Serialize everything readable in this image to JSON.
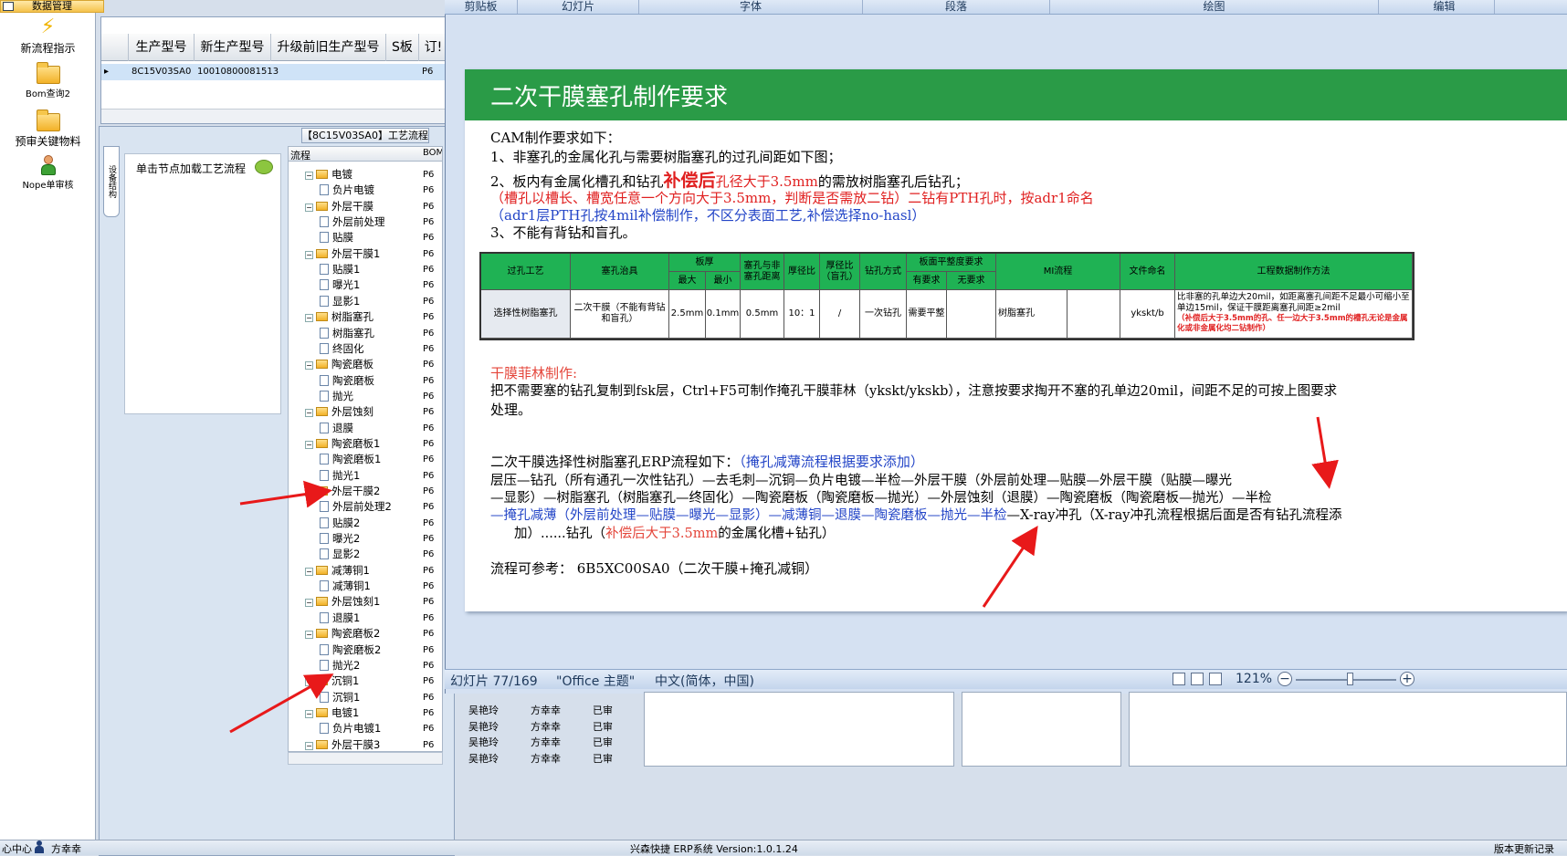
{
  "launcher": {
    "header": "数据管理",
    "items": [
      {
        "label": "新流程指示",
        "icon": "lightning-icon"
      },
      {
        "label": "Bom查询2",
        "icon": "folder-icon"
      },
      {
        "label": "预审关键物料",
        "icon": "folder-icon"
      },
      {
        "label": "Nope单审核",
        "icon": "user-icon"
      }
    ]
  },
  "grid": {
    "columns": [
      "生产型号",
      "新生产型号",
      "升级前旧生产型号",
      "S板",
      "订!"
    ],
    "row": {
      "marker": "▸",
      "c1": "8C15V03SA0",
      "c2": "10010800081513",
      "c3": "P6"
    }
  },
  "process": {
    "title": "【8C15V03SA0】工艺流程",
    "vertical_tab": "设备结构",
    "hint": "单击节点加载工艺流程",
    "tree_header": [
      "流程",
      "BOM_"
    ],
    "nodes": [
      {
        "label": "电镀",
        "level": 0,
        "bom": "P6"
      },
      {
        "label": "负片电镀",
        "level": 1,
        "bom": "P6"
      },
      {
        "label": "外层干膜",
        "level": 0,
        "bom": "P6"
      },
      {
        "label": "外层前处理",
        "level": 1,
        "bom": "P6"
      },
      {
        "label": "贴膜",
        "level": 1,
        "bom": "P6"
      },
      {
        "label": "外层干膜1",
        "level": 0,
        "bom": "P6"
      },
      {
        "label": "贴膜1",
        "level": 1,
        "bom": "P6"
      },
      {
        "label": "曝光1",
        "level": 1,
        "bom": "P6"
      },
      {
        "label": "显影1",
        "level": 1,
        "bom": "P6"
      },
      {
        "label": "树脂塞孔",
        "level": 0,
        "bom": "P6"
      },
      {
        "label": "树脂塞孔",
        "level": 1,
        "bom": "P6"
      },
      {
        "label": "终固化",
        "level": 1,
        "bom": "P6"
      },
      {
        "label": "陶瓷磨板",
        "level": 0,
        "bom": "P6"
      },
      {
        "label": "陶瓷磨板",
        "level": 1,
        "bom": "P6"
      },
      {
        "label": "抛光",
        "level": 1,
        "bom": "P6"
      },
      {
        "label": "外层蚀刻",
        "level": 0,
        "bom": "P6"
      },
      {
        "label": "退膜",
        "level": 1,
        "bom": "P6"
      },
      {
        "label": "陶瓷磨板1",
        "level": 0,
        "bom": "P6"
      },
      {
        "label": "陶瓷磨板1",
        "level": 1,
        "bom": "P6"
      },
      {
        "label": "抛光1",
        "level": 1,
        "bom": "P6"
      },
      {
        "label": "外层干膜2",
        "level": 0,
        "bom": "P6"
      },
      {
        "label": "外层前处理2",
        "level": 1,
        "bom": "P6"
      },
      {
        "label": "贴膜2",
        "level": 1,
        "bom": "P6"
      },
      {
        "label": "曝光2",
        "level": 1,
        "bom": "P6"
      },
      {
        "label": "显影2",
        "level": 1,
        "bom": "P6"
      },
      {
        "label": "减薄铜1",
        "level": 0,
        "bom": "P6"
      },
      {
        "label": "减薄铜1",
        "level": 1,
        "bom": "P6"
      },
      {
        "label": "外层蚀刻1",
        "level": 0,
        "bom": "P6"
      },
      {
        "label": "退膜1",
        "level": 1,
        "bom": "P6"
      },
      {
        "label": "陶瓷磨板2",
        "level": 0,
        "bom": "P6"
      },
      {
        "label": "陶瓷磨板2",
        "level": 1,
        "bom": "P6"
      },
      {
        "label": "抛光2",
        "level": 1,
        "bom": "P6"
      },
      {
        "label": "沉铜1",
        "level": 0,
        "bom": "P6"
      },
      {
        "label": "沉铜1",
        "level": 1,
        "bom": "P6"
      },
      {
        "label": "电镀1",
        "level": 0,
        "bom": "P6"
      },
      {
        "label": "负片电镀1",
        "level": 1,
        "bom": "P6"
      },
      {
        "label": "外层干膜3",
        "level": 0,
        "bom": "P6"
      }
    ],
    "approvals": [
      {
        "a": "吴艳玲",
        "b": "方幸幸",
        "c": "已审"
      },
      {
        "a": "吴艳玲",
        "b": "方幸幸",
        "c": "已审"
      },
      {
        "a": "吴艳玲",
        "b": "方幸幸",
        "c": "已审"
      },
      {
        "a": "吴艳玲",
        "b": "方幸幸",
        "c": "已审"
      }
    ]
  },
  "ppt": {
    "ribbon_groups": [
      "剪贴板",
      "幻灯片",
      "字体",
      "段落",
      "绘图",
      "编辑"
    ],
    "slide_title": "二次干膜塞孔制作要求",
    "lines": {
      "l1": "CAM制作要求如下：",
      "l2": "1、非塞孔的金属化孔与需要树脂塞孔的过孔间距如下图；",
      "l3a": "2、板内有金属化槽孔和钻孔",
      "l3b": "补偿后",
      "l3c": "孔径大于3.5mm",
      "l3d": "的需放树脂塞孔后钻孔；",
      "l4": "（槽孔以槽长、槽宽任意一个方向大于3.5mm，判断是否需放二钻）二钻有PTH孔时，按adr1命名",
      "l5": "（adr1层PTH孔按4mil补偿制作，不区分表面工艺,补偿选择no-hasl）",
      "l6": "3、不能有背钻和盲孔。",
      "fl_title": "干膜菲林制作:",
      "fl1": "把不需要塞的钻孔复制到fsk层，Ctrl+F5可制作掩孔干膜菲林（ykskt/ykskb），注意按要求掏开不塞的孔单边20mil，间距不足的可按上图要求",
      "fl2": "处理。",
      "erp_a": "二次干膜选择性树脂塞孔ERP流程如下：",
      "erp_b": "（掩孔减薄流程根据要求添加）",
      "f1": "层压—钻孔（所有通孔一次性钻孔）—去毛刺—沉铜—负片电镀—半检—外层干膜（外层前处理—贴膜—外层干膜（贴膜—曝光",
      "f2": "—显影）—树脂塞孔（树脂塞孔—终固化）—陶瓷磨板（陶瓷磨板—抛光）—外层蚀刻（退膜）—陶瓷磨板（陶瓷磨板—抛光）—半检",
      "f3a": "—掩孔减薄（外层前处理—贴膜—曝光—显影）—减薄铜—退膜—陶瓷磨板—抛光—半检",
      "f3b": "—X-ray冲孔（X-ray冲孔流程根据后面是否有钻孔流程添",
      "f4a": "加）......钻孔（",
      "f4b": "补偿后大于3.5mm",
      "f4c": "的金属化槽+钻孔）",
      "ref": "流程可参考：   6B5XC00SA0（二次干膜+掩孔减铜）"
    },
    "table": {
      "h": [
        "过孔工艺",
        "塞孔治具",
        "板厚",
        "塞孔与非塞孔距离",
        "厚径比",
        "厚径比（盲孔）",
        "钻孔方式",
        "板面平整度要求",
        "MI流程",
        "文件命名",
        "工程数据制作方法"
      ],
      "sub": [
        "最大",
        "最小",
        "有要求",
        "无要求"
      ],
      "row": [
        "选择性树脂塞孔",
        "二次干膜（不能有背钻和盲孔）",
        "2.5mm",
        "0.1mm",
        "0.5mm",
        "10：1",
        "/",
        "一次钻孔",
        "需要平整",
        "",
        "树脂塞孔",
        "",
        "ykskt/b"
      ],
      "method1": "比非塞的孔单边大20mil，如距离塞孔间距不足最小可缩小至单边15mil，保证干膜距离塞孔间距≥2mil",
      "method2": "（补偿后大于3.5mm的孔、任一边大于3.5mm的槽孔无论是金属化或非金属化均二钻制作）"
    },
    "status": {
      "slide": "幻灯片 77/169",
      "theme": "\"Office 主题\"",
      "lang": "中文(简体，中国)",
      "zoom": "121%"
    }
  },
  "footer": {
    "left1": "心中心",
    "user": "方幸幸",
    "center": "兴森快捷  ERP系统 Version:1.0.1.24",
    "right": "版本更新记录"
  }
}
